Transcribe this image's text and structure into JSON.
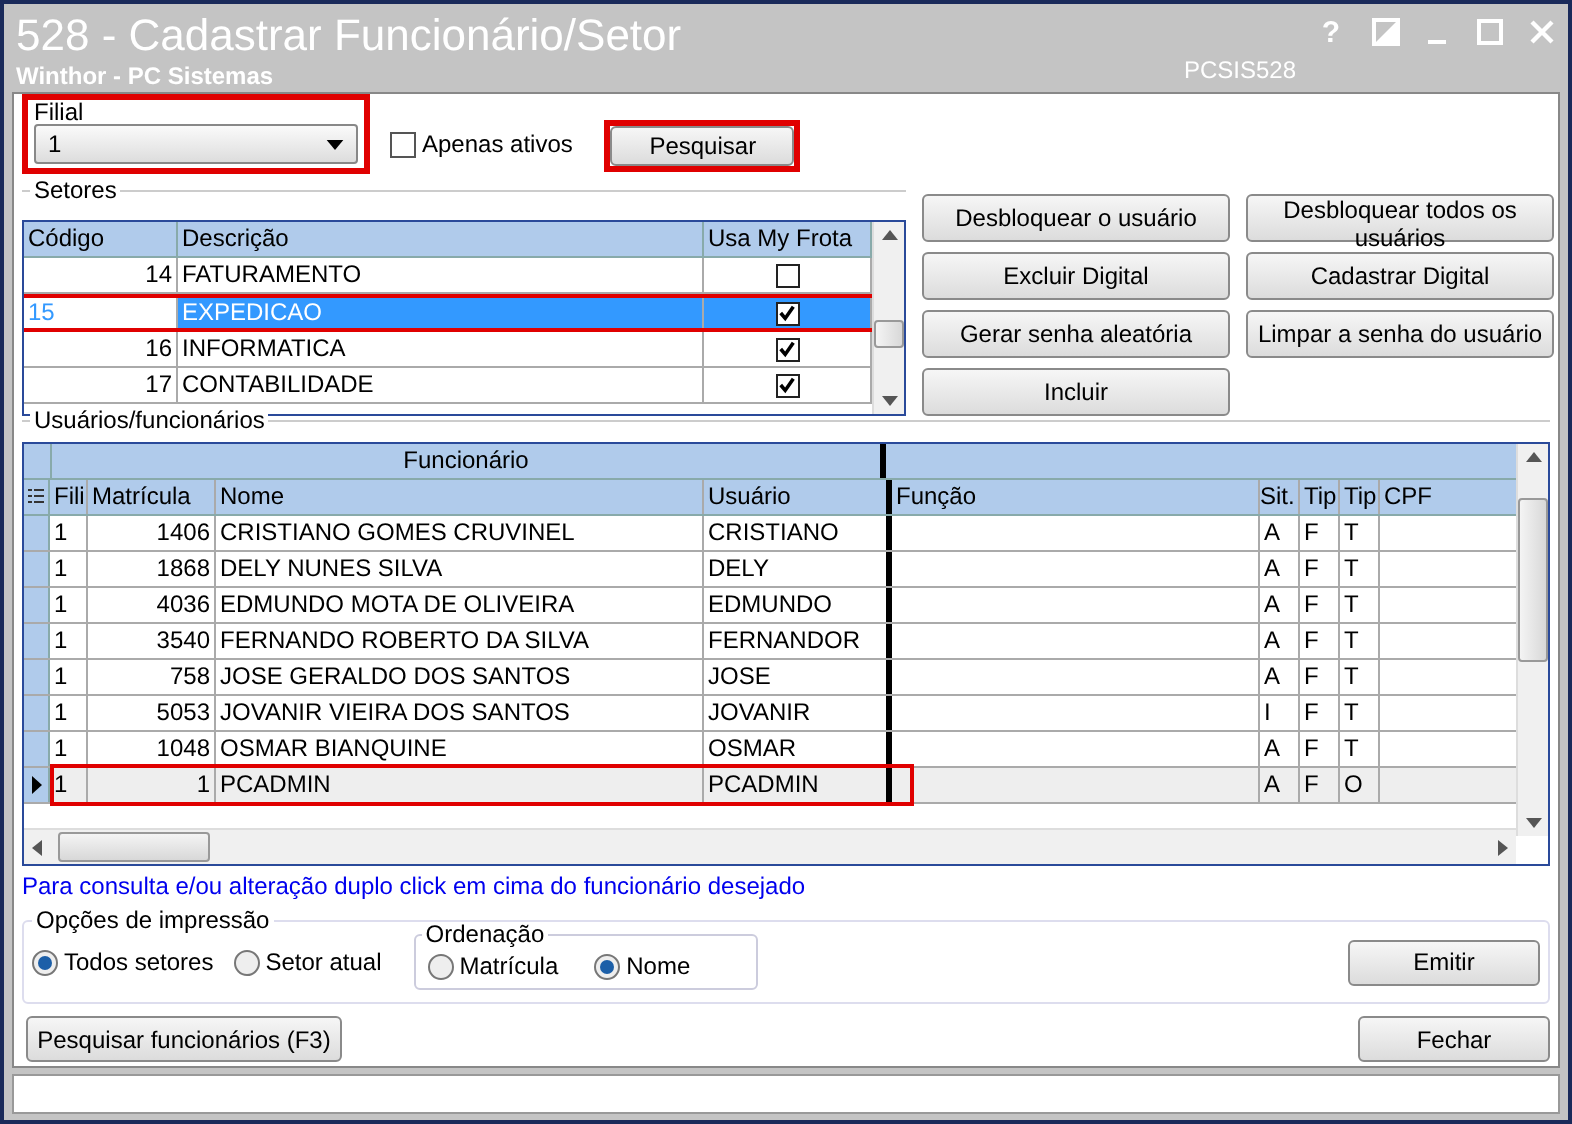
{
  "window": {
    "title": "528 - Cadastrar Funcionário/Setor",
    "subtitle": "Winthor - PC Sistemas",
    "code": "PCSIS528",
    "help": "?"
  },
  "filial": {
    "label": "Filial",
    "value": "1",
    "highlighted": true
  },
  "apenas_ativos": {
    "label": "Apenas ativos",
    "checked": false
  },
  "pesquisar": {
    "label": "Pesquisar",
    "highlighted": true
  },
  "setores": {
    "title": "Setores",
    "columns": [
      "Código",
      "Descrição",
      "Usa My Frota"
    ],
    "rows": [
      {
        "codigo": "14",
        "descricao": "FATURAMENTO",
        "usa_my_frota": false,
        "selected": false,
        "highlighted": false
      },
      {
        "codigo": "15",
        "descricao": "EXPEDICAO",
        "usa_my_frota": true,
        "selected": true,
        "highlighted": true
      },
      {
        "codigo": "16",
        "descricao": "INFORMATICA",
        "usa_my_frota": true,
        "selected": false,
        "highlighted": false
      },
      {
        "codigo": "17",
        "descricao": "CONTABILIDADE",
        "usa_my_frota": true,
        "selected": false,
        "highlighted": false
      }
    ]
  },
  "actions": [
    "Desbloquear o usuário",
    "Desbloquear todos os usuários",
    "Excluir Digital",
    "Cadastrar Digital",
    "Gerar senha aleatória",
    "Limpar a senha do usuário",
    "Incluir"
  ],
  "usuarios": {
    "title": "Usuários/funcionários",
    "group_header": "Funcionário",
    "columns": [
      "Fili",
      "Matrícula",
      "Nome",
      "Usuário",
      "Função",
      "Sit.",
      "Tip",
      "Tip",
      "CPF"
    ],
    "rows": [
      {
        "filial": "1",
        "matricula": "1406",
        "nome": "CRISTIANO GOMES CRUVINEL",
        "usuario": "CRISTIANO",
        "sit": "A",
        "tip_1": "F",
        "tip_2": "T",
        "current": false,
        "highlighted": false
      },
      {
        "filial": "1",
        "matricula": "1868",
        "nome": "DELY NUNES SILVA",
        "usuario": "DELY",
        "sit": "A",
        "tip_1": "F",
        "tip_2": "T",
        "current": false,
        "highlighted": false
      },
      {
        "filial": "1",
        "matricula": "4036",
        "nome": "EDMUNDO MOTA DE OLIVEIRA",
        "usuario": "EDMUNDO",
        "sit": "A",
        "tip_1": "F",
        "tip_2": "T",
        "current": false,
        "highlighted": false
      },
      {
        "filial": "1",
        "matricula": "3540",
        "nome": "FERNANDO ROBERTO DA SILVA",
        "usuario": "FERNANDOR",
        "sit": "A",
        "tip_1": "F",
        "tip_2": "T",
        "current": false,
        "highlighted": false
      },
      {
        "filial": "1",
        "matricula": "758",
        "nome": "JOSE GERALDO DOS SANTOS",
        "usuario": "JOSE",
        "sit": "A",
        "tip_1": "F",
        "tip_2": "T",
        "current": false,
        "highlighted": false
      },
      {
        "filial": "1",
        "matricula": "5053",
        "nome": "JOVANIR VIEIRA DOS SANTOS",
        "usuario": "JOVANIR",
        "sit": "I",
        "tip_1": "F",
        "tip_2": "T",
        "current": false,
        "highlighted": false
      },
      {
        "filial": "1",
        "matricula": "1048",
        "nome": "OSMAR BIANQUINE",
        "usuario": "OSMAR",
        "sit": "A",
        "tip_1": "F",
        "tip_2": "T",
        "current": false,
        "highlighted": false
      },
      {
        "filial": "1",
        "matricula": "1",
        "nome": "PCADMIN",
        "usuario": "PCADMIN",
        "sit": "A",
        "tip_1": "F",
        "tip_2": "O",
        "current": true,
        "highlighted": true
      }
    ]
  },
  "hint": "Para consulta e/ou alteração duplo click em cima do funcionário desejado",
  "impressao": {
    "title": "Opções de impressão",
    "options": [
      {
        "label": "Todos setores",
        "selected": true
      },
      {
        "label": "Setor atual",
        "selected": false
      }
    ]
  },
  "ordenacao": {
    "title": "Ordenação",
    "options": [
      {
        "label": "Matrícula",
        "selected": false
      },
      {
        "label": "Nome",
        "selected": true
      }
    ]
  },
  "emitir": "Emitir",
  "pesquisar_funcionarios": "Pesquisar funcionários (F3)",
  "fechar": "Fechar"
}
